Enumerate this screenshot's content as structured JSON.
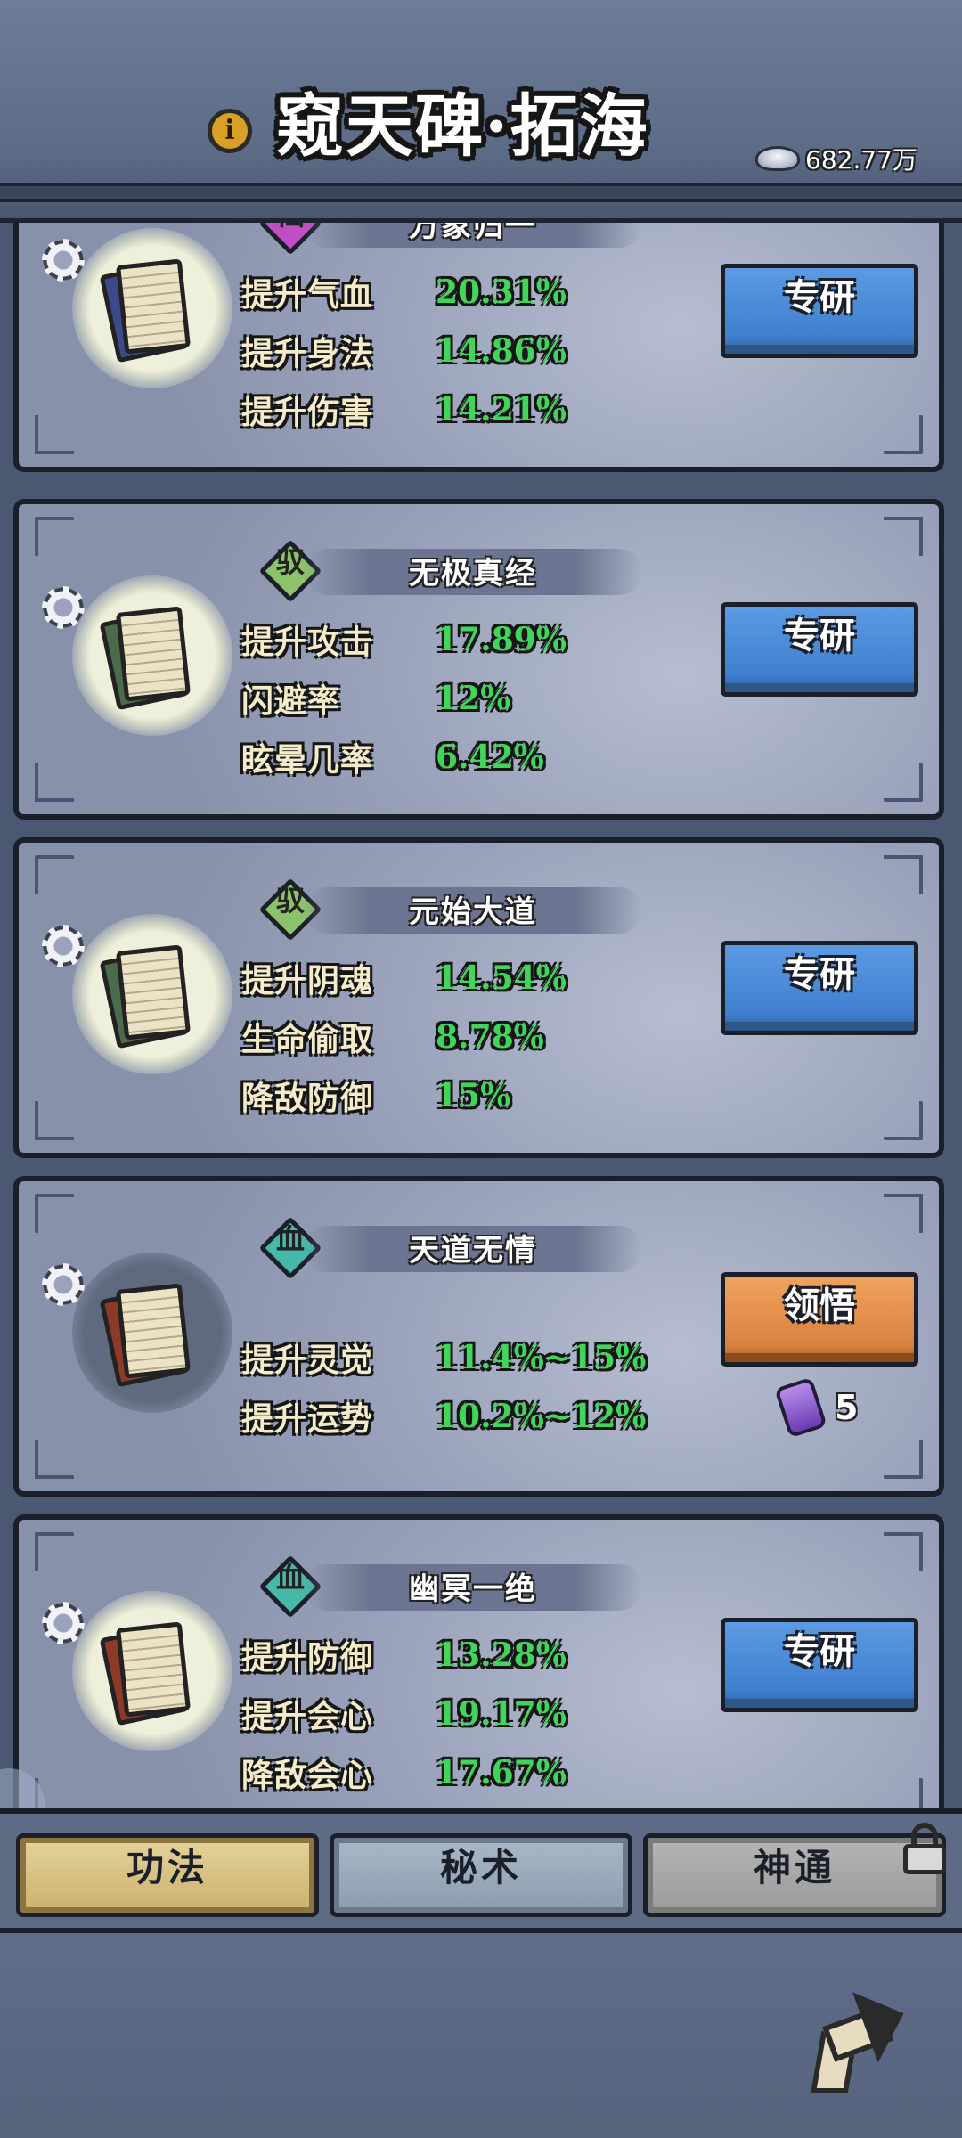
{
  "header": {
    "title": "窥天碑·拓海",
    "info_icon": "i",
    "currency": {
      "icon": "silver-ingot-icon",
      "value": "682.77万"
    }
  },
  "cards": [
    {
      "rank": "仙",
      "rank_color": "#c04fc4",
      "name": "万象归一",
      "icon_tint": "#3c4a8a",
      "stats": [
        {
          "label": "提升气血",
          "value": "20.31%"
        },
        {
          "label": "提升身法",
          "value": "14.86%"
        },
        {
          "label": "提升伤害",
          "value": "14.21%"
        }
      ],
      "action": "专研",
      "action_color": "blue"
    },
    {
      "rank": "驭",
      "rank_color": "#8bc26a",
      "name": "无极真经",
      "icon_tint": "#4c6a4c",
      "stats": [
        {
          "label": "提升攻击",
          "value": "17.89%"
        },
        {
          "label": "闪避率",
          "value": "12%"
        },
        {
          "label": "眩晕几率",
          "value": "6.42%"
        }
      ],
      "action": "专研",
      "action_color": "blue"
    },
    {
      "rank": "驭",
      "rank_color": "#8bc26a",
      "name": "元始大道",
      "icon_tint": "#4c6a4c",
      "stats": [
        {
          "label": "提升阴魂",
          "value": "14.54%"
        },
        {
          "label": "生命偷取",
          "value": "8.78%"
        },
        {
          "label": "降敌防御",
          "value": "15%"
        }
      ],
      "action": "专研",
      "action_color": "blue"
    },
    {
      "rank": "血",
      "rank_color": "#46b8a8",
      "name": "天道无情",
      "icon_tint": "#8c3a2a",
      "stats": [
        {
          "label": "提升灵觉",
          "value": "11.4%~15%"
        },
        {
          "label": "提升运势",
          "value": "10.2%~12%"
        }
      ],
      "action": "领悟",
      "action_color": "orange",
      "cost": {
        "icon": "purple-scroll-icon",
        "value": "5"
      }
    },
    {
      "rank": "血",
      "rank_color": "#46b8a8",
      "name": "幽冥一绝",
      "icon_tint": "#8c3a2a",
      "stats": [
        {
          "label": "提升防御",
          "value": "13.28%"
        },
        {
          "label": "提升会心",
          "value": "19.17%"
        },
        {
          "label": "降敌会心",
          "value": "17.67%"
        }
      ],
      "action": "专研",
      "action_color": "blue"
    }
  ],
  "tabs": [
    {
      "label": "功法",
      "state": "active"
    },
    {
      "label": "秘术",
      "state": "normal"
    },
    {
      "label": "神通",
      "state": "locked"
    }
  ],
  "bottom": {
    "back_icon": "back-arrow-icon"
  }
}
